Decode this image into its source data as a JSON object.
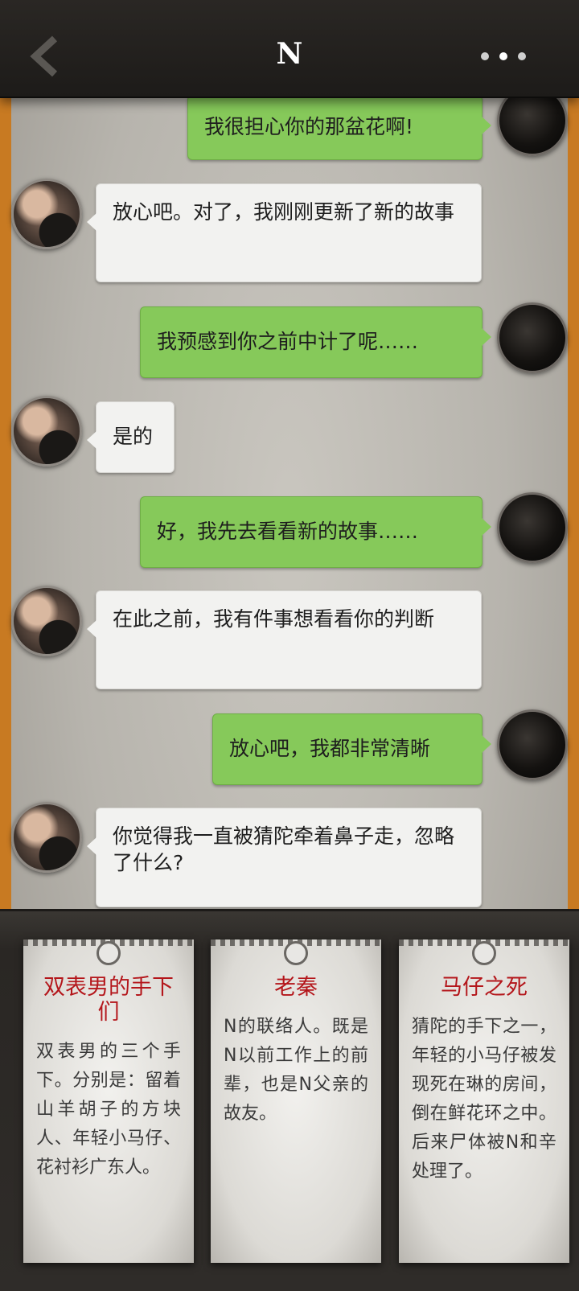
{
  "header": {
    "title": "N"
  },
  "messages": [
    {
      "side": "right",
      "text": "我很担心你的那盆花啊!"
    },
    {
      "side": "left",
      "text": "放心吧。对了，我刚刚更新了新的故事"
    },
    {
      "side": "right",
      "text": "我预感到你之前中计了呢……"
    },
    {
      "side": "left",
      "text": "是的"
    },
    {
      "side": "right",
      "text": "好，我先去看看新的故事……"
    },
    {
      "side": "left",
      "text": "在此之前，我有件事想看看你的判断"
    },
    {
      "side": "right",
      "text": "放心吧，我都非常清晰"
    },
    {
      "side": "left",
      "text": "你觉得我一直被猜陀牵着鼻子走，忽略了什么?"
    }
  ],
  "cards": [
    {
      "title": "双表男的手下们",
      "body": "双表男的三个手下。分别是：留着山羊胡子的方块人、年轻小马仔、花衬衫广东人。"
    },
    {
      "title": "老秦",
      "body": "N的联络人。既是N以前工作上的前辈，也是N父亲的故友。"
    },
    {
      "title": "马仔之死",
      "body": "猜陀的手下之一，年轻的小马仔被发现死在琳的房间，倒在鲜花环之中。后来尸体被N和辛处理了。"
    }
  ]
}
